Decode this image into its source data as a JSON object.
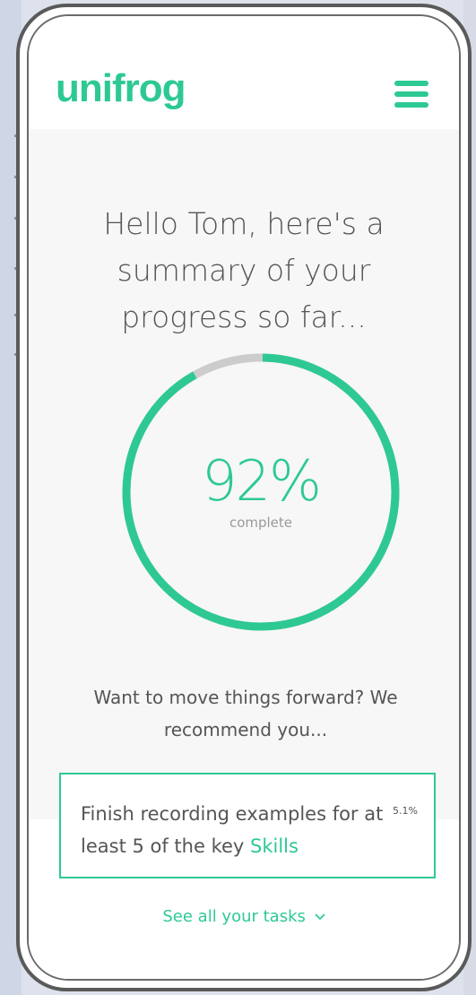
{
  "header": {
    "logo": "unifrog",
    "menu_icon": "hamburger-icon"
  },
  "summary": {
    "greeting": "Hello Tom, here's a summary of your progress so far...",
    "progress_value": "92%",
    "progress_fraction": 0.92,
    "progress_label": "complete",
    "recommend_text": "Want to move things forward? We recommend you..."
  },
  "task": {
    "text": "Finish recording examples for at least 5 of the key ",
    "link": "Skills",
    "percent": "5.1%"
  },
  "footer": {
    "see_all": "See all your tasks",
    "chevron_icon": "chevron-down-icon"
  },
  "colors": {
    "accent": "#2ec993",
    "ring_track": "#cccccc",
    "text": "#555555"
  }
}
